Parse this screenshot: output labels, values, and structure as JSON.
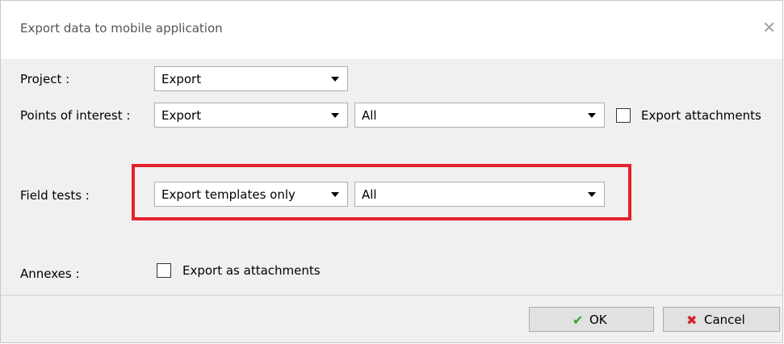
{
  "dialog": {
    "title": "Export data to mobile application",
    "close_label": "✕"
  },
  "rows": {
    "project": {
      "label": "Project :",
      "select": "Export"
    },
    "poi": {
      "label": "Points of interest :",
      "select": "Export",
      "filter": "All",
      "checkbox_label": "Export attachments",
      "checked": false
    },
    "field_tests": {
      "label": "Field tests :",
      "select": "Export templates only",
      "filter": "All"
    },
    "annexes": {
      "label": "Annexes :",
      "checkbox_label": "Export as attachments",
      "checked": false
    }
  },
  "buttons": {
    "ok": {
      "label": "OK",
      "icon": "✔"
    },
    "cancel": {
      "label": "Cancel",
      "icon": "✖"
    }
  },
  "colors": {
    "highlight": "#e4222b",
    "ok_icon": "#2aa530",
    "cancel_icon": "#d6202a"
  }
}
